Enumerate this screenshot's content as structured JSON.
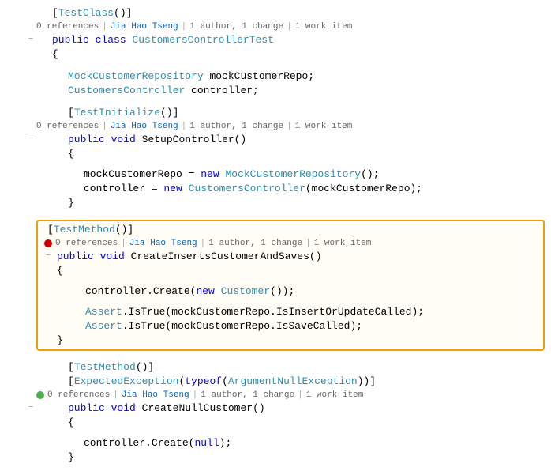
{
  "colors": {
    "keyword": "#0000ff",
    "type": "#2b91af",
    "string": "#a31515",
    "comment": "#008000",
    "text": "#000000",
    "meta": "#666666",
    "highlight_border": "#f0a000",
    "error": "#cc0000",
    "ok": "#4caf50",
    "link": "#0066cc"
  },
  "lines": [
    {
      "id": 1,
      "type": "code",
      "indent": 1,
      "tokens": "[TestClass()]"
    },
    {
      "id": 2,
      "type": "meta",
      "content": "0 references | Jia Hao Tseng | 1 author, 1 change | 1 work item"
    },
    {
      "id": 3,
      "type": "code",
      "indent": 1,
      "tokens": "public class CustomersControllerTest"
    },
    {
      "id": 4,
      "type": "code",
      "indent": 1,
      "tokens": "{",
      "collapse": true
    },
    {
      "id": 5,
      "type": "code",
      "indent": 2,
      "tokens": ""
    },
    {
      "id": 6,
      "type": "code",
      "indent": 2,
      "tokens": "MockCustomerRepository mockCustomerRepo;"
    },
    {
      "id": 7,
      "type": "code",
      "indent": 2,
      "tokens": "CustomersController controller;"
    },
    {
      "id": 8,
      "type": "code",
      "indent": 2,
      "tokens": ""
    },
    {
      "id": 9,
      "type": "code",
      "indent": 2,
      "tokens": "[TestInitialize()]"
    },
    {
      "id": 10,
      "type": "meta",
      "content": "0 references | Jia Hao Tseng | 1 author, 1 change | 1 work item"
    },
    {
      "id": 11,
      "type": "code",
      "indent": 2,
      "tokens": "public void SetupController()"
    },
    {
      "id": 12,
      "type": "code",
      "indent": 2,
      "tokens": "{",
      "collapse": true
    },
    {
      "id": 13,
      "type": "code",
      "indent": 3,
      "tokens": ""
    },
    {
      "id": 14,
      "type": "code",
      "indent": 3,
      "tokens": "mockCustomerRepo = new MockCustomerRepository();"
    },
    {
      "id": 15,
      "type": "code",
      "indent": 3,
      "tokens": "controller = new CustomersController(mockCustomerRepo);"
    },
    {
      "id": 16,
      "type": "code",
      "indent": 2,
      "tokens": "}"
    },
    {
      "id": 17,
      "type": "code",
      "indent": 2,
      "tokens": ""
    },
    {
      "id": 18,
      "type": "code",
      "indent": 2,
      "tokens": "[TestMethod()]",
      "highlight": true
    },
    {
      "id": 19,
      "type": "meta_error",
      "content": "0 references | Jia Hao Tseng | 1 author, 1 change | 1 work item",
      "highlight": true
    },
    {
      "id": 20,
      "type": "code",
      "indent": 2,
      "tokens": "public void CreateInsertsCustomerAndSaves()",
      "highlight": true
    },
    {
      "id": 21,
      "type": "code",
      "indent": 2,
      "tokens": "{",
      "highlight": true,
      "collapse": true
    },
    {
      "id": 22,
      "type": "code",
      "indent": 3,
      "tokens": "",
      "highlight": true
    },
    {
      "id": 23,
      "type": "code",
      "indent": 3,
      "tokens": "controller.Create(new Customer());",
      "highlight": true
    },
    {
      "id": 24,
      "type": "code",
      "indent": 3,
      "tokens": "",
      "highlight": true
    },
    {
      "id": 25,
      "type": "code",
      "indent": 3,
      "tokens": "Assert.IsTrue(mockCustomerRepo.IsInsertOrUpdateCalled);",
      "highlight": true
    },
    {
      "id": 26,
      "type": "code",
      "indent": 3,
      "tokens": "Assert.IsTrue(mockCustomerRepo.IsSaveCalled);",
      "highlight": true
    },
    {
      "id": 27,
      "type": "code",
      "indent": 2,
      "tokens": "}",
      "highlight": true
    },
    {
      "id": 28,
      "type": "code",
      "indent": 2,
      "tokens": ""
    },
    {
      "id": 29,
      "type": "code",
      "indent": 2,
      "tokens": "[TestMethod()]"
    },
    {
      "id": 30,
      "type": "code",
      "indent": 2,
      "tokens": "[ExpectedException(typeof(ArgumentNullException))]"
    },
    {
      "id": 31,
      "type": "meta_ok",
      "content": "0 references | Jia Hao Tseng | 1 author, 1 change | 1 work item"
    },
    {
      "id": 32,
      "type": "code",
      "indent": 2,
      "tokens": "public void CreateNullCustomer()"
    },
    {
      "id": 33,
      "type": "code",
      "indent": 2,
      "tokens": "{",
      "collapse": true
    },
    {
      "id": 34,
      "type": "code",
      "indent": 3,
      "tokens": ""
    },
    {
      "id": 35,
      "type": "code",
      "indent": 3,
      "tokens": "controller.Create(null);"
    },
    {
      "id": 36,
      "type": "code",
      "indent": 2,
      "tokens": "}"
    }
  ]
}
